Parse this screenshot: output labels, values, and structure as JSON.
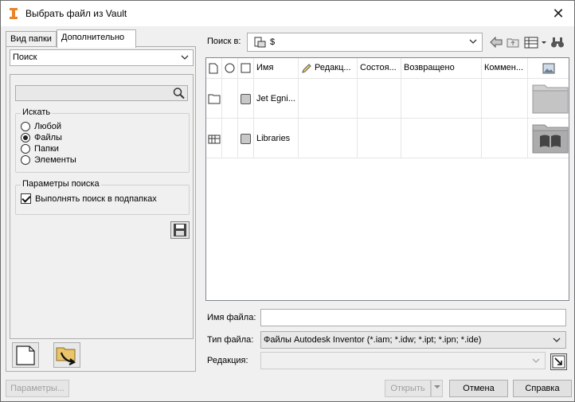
{
  "window": {
    "title": "Выбрать файл из Vault"
  },
  "left": {
    "tabs": [
      "Вид папки",
      "Дополнительно"
    ],
    "mode": "Поиск",
    "search": {
      "value": "",
      "placeholder": ""
    },
    "look_for": {
      "title": "Искать",
      "options": [
        "Любой",
        "Файлы",
        "Папки",
        "Элементы"
      ],
      "selected": "Файлы"
    },
    "params": {
      "title": "Параметры поиска",
      "checkbox": "Выполнять поиск в подпапках",
      "checked": true
    }
  },
  "lookin": {
    "label": "Поиск в:",
    "value": "$"
  },
  "columns": [
    "Имя",
    "Редакц...",
    "Состоя...",
    "Возвращено",
    "Коммен..."
  ],
  "rows": [
    {
      "name": "Jet Egni...",
      "type": "folder"
    },
    {
      "name": "Libraries",
      "type": "library"
    }
  ],
  "form": {
    "filename_label": "Имя файла:",
    "filename_value": "",
    "filetype_label": "Тип файла:",
    "filetype_value": "Файлы Autodesk Inventor (*.iam; *.idw; *.ipt; *.ipn; *.ide)",
    "revision_label": "Редакция:",
    "revision_value": ""
  },
  "buttons": {
    "params": "Параметры...",
    "open": "Открыть",
    "cancel": "Отмена",
    "help": "Справка"
  },
  "colors": {
    "accent": "#0078d7",
    "folder": "#d4d4d4"
  }
}
